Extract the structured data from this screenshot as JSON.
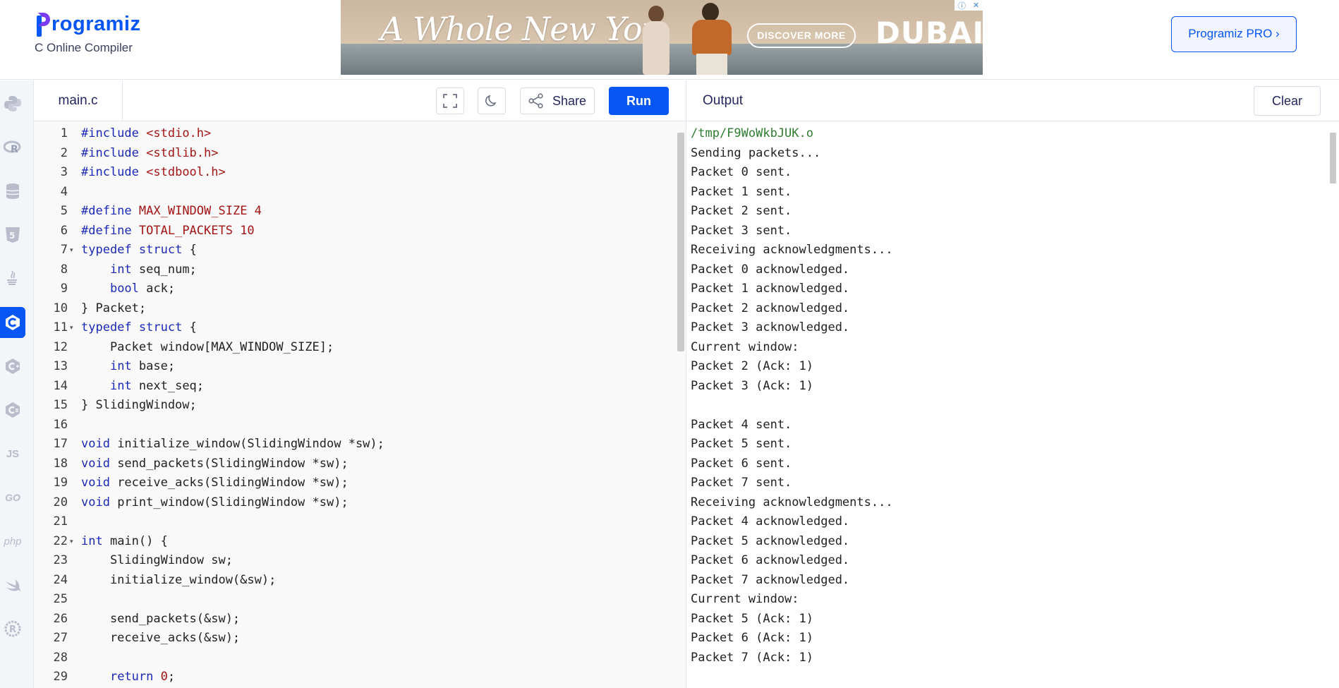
{
  "header": {
    "logo_text": "rogramiz",
    "subtitle": "C Online Compiler",
    "pro_label": "Programiz PRO ›"
  },
  "ad": {
    "headline": "A Whole New You",
    "cta": "DISCOVER MORE",
    "brand": "DUBAI",
    "info_glyph": "ⓘ",
    "close_glyph": "✕"
  },
  "sidebar": {
    "items": [
      {
        "icon": "python-icon",
        "glyph": ""
      },
      {
        "icon": "r-language-icon",
        "glyph": "R"
      },
      {
        "icon": "database-icon",
        "glyph": ""
      },
      {
        "icon": "html5-icon",
        "glyph": "5"
      },
      {
        "icon": "java-icon",
        "glyph": ""
      },
      {
        "icon": "c-language-icon",
        "glyph": "C",
        "active": true
      },
      {
        "icon": "cpp-icon",
        "glyph": "C"
      },
      {
        "icon": "csharp-icon",
        "glyph": "C"
      },
      {
        "icon": "javascript-icon",
        "glyph": "JS"
      },
      {
        "icon": "go-icon",
        "glyph": "GO"
      },
      {
        "icon": "php-icon",
        "glyph": "php"
      },
      {
        "icon": "swift-icon",
        "glyph": ""
      },
      {
        "icon": "rust-icon",
        "glyph": "R"
      }
    ]
  },
  "editor": {
    "file_tab": "main.c",
    "share_label": "Share",
    "run_label": "Run",
    "lines": [
      "#include <stdio.h>",
      "#include <stdlib.h>",
      "#include <stdbool.h>",
      "",
      "#define MAX_WINDOW_SIZE 4",
      "#define TOTAL_PACKETS 10",
      "typedef struct {",
      "    int seq_num;",
      "    bool ack;",
      "} Packet;",
      "typedef struct {",
      "    Packet window[MAX_WINDOW_SIZE];",
      "    int base;",
      "    int next_seq;",
      "} SlidingWindow;",
      "",
      "void initialize_window(SlidingWindow *sw);",
      "void send_packets(SlidingWindow *sw);",
      "void receive_acks(SlidingWindow *sw);",
      "void print_window(SlidingWindow *sw);",
      "",
      "int main() {",
      "    SlidingWindow sw;",
      "    initialize_window(&sw);",
      "",
      "    send_packets(&sw);",
      "    receive_acks(&sw);",
      "",
      "    return 0;"
    ],
    "fold_lines": [
      7,
      11,
      22
    ]
  },
  "output": {
    "title": "Output",
    "clear_label": "Clear",
    "lines": [
      "/tmp/F9WoWkbJUK.o",
      "Sending packets...",
      "Packet 0 sent.",
      "Packet 1 sent.",
      "Packet 2 sent.",
      "Packet 3 sent.",
      "Receiving acknowledgments...",
      "Packet 0 acknowledged.",
      "Packet 1 acknowledged.",
      "Packet 2 acknowledged.",
      "Packet 3 acknowledged.",
      "Current window:",
      "Packet 2 (Ack: 1)",
      "Packet 3 (Ack: 1)",
      "",
      "Packet 4 sent.",
      "Packet 5 sent.",
      "Packet 6 sent.",
      "Packet 7 sent.",
      "Receiving acknowledgments...",
      "Packet 4 acknowledged.",
      "Packet 5 acknowledged.",
      "Packet 6 acknowledged.",
      "Packet 7 acknowledged.",
      "Current window:",
      "Packet 5 (Ack: 1)",
      "Packet 6 (Ack: 1)",
      "Packet 7 (Ack: 1)"
    ]
  },
  "colors": {
    "brand_blue": "#0556f3",
    "keyword": "#1b29b6",
    "string": "#a31515",
    "output_path": "#2e7d32"
  }
}
